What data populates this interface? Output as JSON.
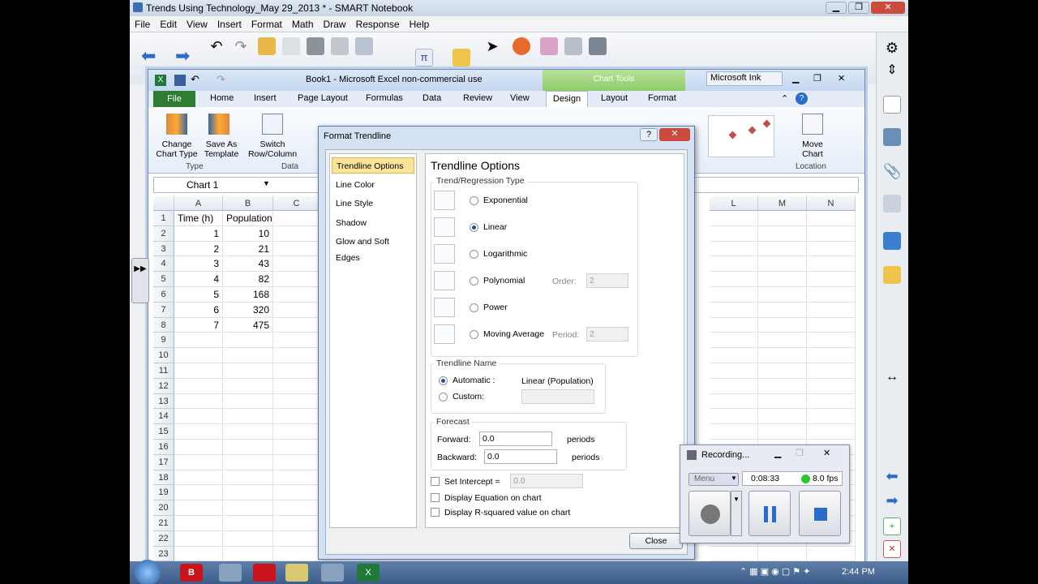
{
  "window_title": "Trends Using Technology_May 29_2013 * - SMART Notebook",
  "sn_menu": [
    "File",
    "Edit",
    "View",
    "Insert",
    "Format",
    "Math",
    "Draw",
    "Response",
    "Help"
  ],
  "excel": {
    "title": "Book1 - Microsoft Excel non-commercial use",
    "chart_tools": "Chart Tools",
    "ink": "Microsoft Ink",
    "tabs": [
      "File",
      "Home",
      "Insert",
      "Page Layout",
      "Formulas",
      "Data",
      "Review",
      "View",
      "Design",
      "Layout",
      "Format"
    ],
    "ribbon": {
      "change_chart_type": "Change Chart Type",
      "save_as_template": "Save As Template",
      "type_group": "Type",
      "switch": "Switch Row/Column",
      "data_group": "Data",
      "move_chart": "Move Chart",
      "location_group": "Location"
    },
    "name_box": "Chart 1",
    "columns": [
      "A",
      "B",
      "C",
      "L",
      "M",
      "N"
    ],
    "rows": [
      "1",
      "2",
      "3",
      "4",
      "5",
      "6",
      "7",
      "8",
      "9",
      "10",
      "11",
      "12",
      "13",
      "14",
      "15",
      "16",
      "17",
      "18",
      "19",
      "20",
      "21",
      "22",
      "23"
    ],
    "header_a": "Time (h)",
    "header_b": "Population",
    "time": [
      "1",
      "2",
      "3",
      "4",
      "5",
      "6",
      "7"
    ],
    "population": [
      "10",
      "21",
      "43",
      "82",
      "168",
      "320",
      "475"
    ]
  },
  "dialog": {
    "title": "Format Trendline",
    "nav": [
      "Trendline Options",
      "Line Color",
      "Line Style",
      "Shadow",
      "Glow and Soft Edges"
    ],
    "heading": "Trendline Options",
    "type_group": "Trend/Regression Type",
    "types": [
      "Exponential",
      "Linear",
      "Logarithmic",
      "Polynomial",
      "Power",
      "Moving Average"
    ],
    "order_label": "Order:",
    "order_value": "2",
    "period_label": "Period:",
    "period_value": "2",
    "name_group": "Trendline Name",
    "automatic": "Automatic :",
    "auto_value": "Linear (Population)",
    "custom": "Custom:",
    "forecast_group": "Forecast",
    "forward": "Forward:",
    "forward_value": "0.0",
    "backward": "Backward:",
    "backward_value": "0.0",
    "periods": "periods",
    "set_intercept": "Set Intercept =",
    "intercept_value": "0.0",
    "display_equation": "Display Equation on chart",
    "display_r2": "Display R-squared value on chart",
    "close": "Close"
  },
  "recorder": {
    "title": "Recording...",
    "menu": "Menu",
    "time": "0:08:33",
    "fps": "8.0 fps"
  },
  "clock": "2:44 PM"
}
